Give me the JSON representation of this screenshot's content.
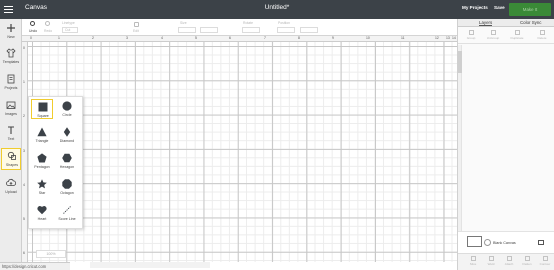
{
  "app": {
    "name": "Canvas",
    "document_title": "Untitled*"
  },
  "header": {
    "my_projects": "My Projects",
    "save": "Save",
    "make_it": "Make It"
  },
  "toolbar": {
    "undo": "Undo",
    "redo": "Redo",
    "linetype": "Linetype",
    "linetype_value": "Cut",
    "edit": "Edit",
    "size": "Size",
    "rotate": "Rotate",
    "position": "Position"
  },
  "ruler": {
    "top": [
      "0",
      "1",
      "2",
      "3",
      "4",
      "5",
      "6",
      "7",
      "8",
      "9",
      "10",
      "11",
      "12",
      "13",
      "14"
    ],
    "left": [
      "0",
      "1",
      "2",
      "3",
      "4",
      "5",
      "6"
    ]
  },
  "nav": {
    "items": [
      {
        "label": "New",
        "icon": "plus-icon"
      },
      {
        "label": "Templates",
        "icon": "tshirt-icon"
      },
      {
        "label": "Projects",
        "icon": "projects-icon"
      },
      {
        "label": "Images",
        "icon": "image-icon"
      },
      {
        "label": "Text",
        "icon": "text-icon"
      },
      {
        "label": "Shapes",
        "icon": "shapes-icon",
        "active": true
      },
      {
        "label": "Upload",
        "icon": "upload-icon"
      }
    ]
  },
  "shapes": {
    "items": [
      {
        "label": "Square",
        "icon": "square-icon",
        "selected": true
      },
      {
        "label": "Circle",
        "icon": "circle-icon"
      },
      {
        "label": "Triangle",
        "icon": "triangle-icon"
      },
      {
        "label": "Diamond",
        "icon": "diamond-icon"
      },
      {
        "label": "Pentagon",
        "icon": "pentagon-icon"
      },
      {
        "label": "Hexagon",
        "icon": "hexagon-icon"
      },
      {
        "label": "Star",
        "icon": "star-icon"
      },
      {
        "label": "Octagon",
        "icon": "octagon-icon"
      },
      {
        "label": "Heart",
        "icon": "heart-icon"
      },
      {
        "label": "Score Line",
        "icon": "score-line-icon"
      }
    ]
  },
  "panel": {
    "tabs": [
      "Layers",
      "Color Sync"
    ],
    "tools": [
      "Group",
      "UnGroup",
      "Duplicate",
      "Delete"
    ],
    "blank_canvas": "Blank Canvas",
    "bottom_tools": [
      "Slice",
      "Weld",
      "Attach",
      "Flatten",
      "Contour"
    ]
  },
  "status": {
    "url": "https://design.cricut.com"
  },
  "zoom": {
    "value": "100%"
  },
  "colors": {
    "header": "#3c4248",
    "accent": "#3a8a37",
    "highlight": "#f0cc2e",
    "shape_fill": "#3c4248"
  }
}
